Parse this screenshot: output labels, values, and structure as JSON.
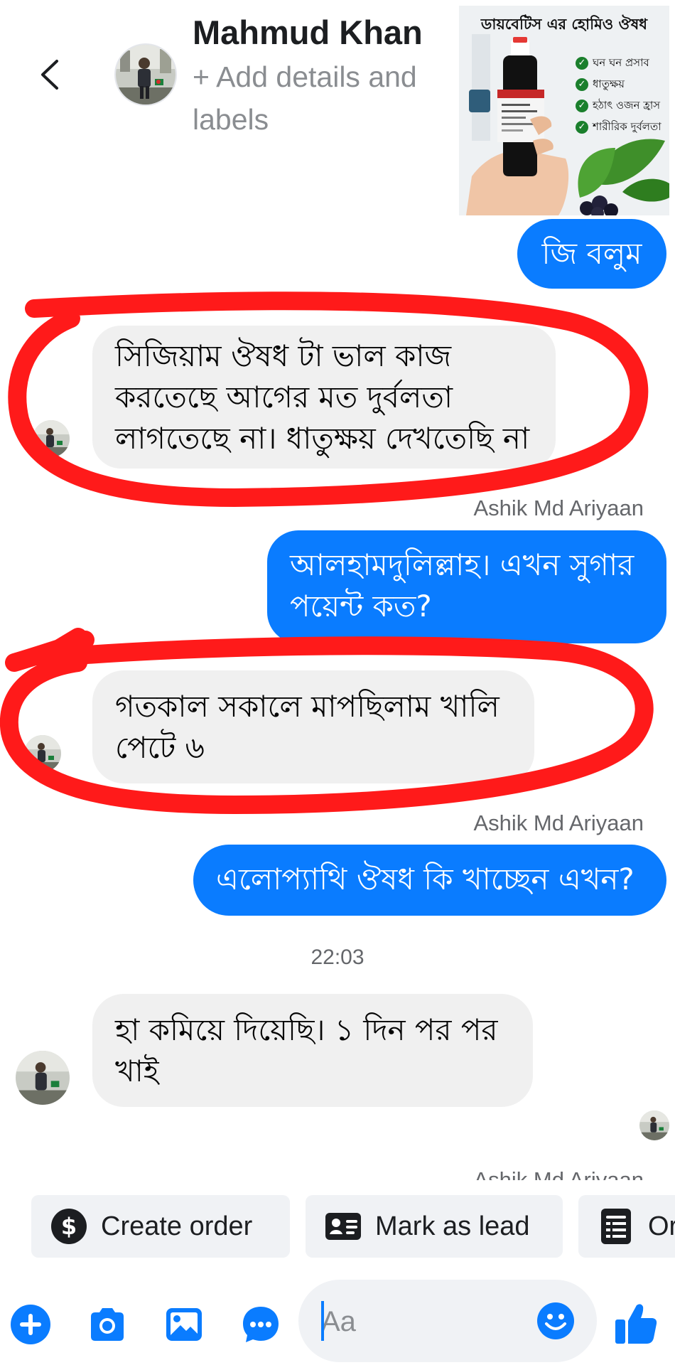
{
  "header": {
    "contact_name": "Mahmud Khan",
    "add_details_label": "+ Add details and labels"
  },
  "ad": {
    "title": "ডায়বেটিস এর হোমিও ঔষধ",
    "features": [
      "ঘন ঘন প্রসাব",
      "ধাতুক্ষয়",
      "হঠাৎ ওজন হ্রাস",
      "শারীরিক দুর্বলতা"
    ],
    "bottle_label": "Syzygium Jambolanum"
  },
  "messages": [
    {
      "dir": "out",
      "text": "জি বলুম"
    },
    {
      "dir": "in",
      "lines": [
        "সিজিয়াম ঔষধ টা ভাল কাজ",
        "করতেছে আগের মত দুর্বলতা",
        "লাগতেছে না। ধাতুক্ষয় দেখতেছি না"
      ]
    },
    {
      "sender": "Ashik Md Ariyaan"
    },
    {
      "dir": "out",
      "lines": [
        "আলহামদুলিল্লাহ। এখন সুগার",
        "পয়েন্ট কত?"
      ]
    },
    {
      "dir": "in",
      "lines": [
        "গতকাল সকালে মাপছিলাম খালি",
        "পেটে ৬"
      ]
    },
    {
      "sender": "Ashik Md Ariyaan"
    },
    {
      "dir": "out",
      "text": "এলোপ্যাথি ঔষধ কি খাচ্ছেন এখন?"
    },
    {
      "timestamp": "22:03"
    },
    {
      "dir": "in",
      "lines": [
        "হা কমিয়ে দিয়েছি। ১ দিন পর পর",
        "খাই"
      ]
    },
    {
      "sender": "Ashik Md Ariyaan"
    }
  ],
  "actions": {
    "create_order": "Create order",
    "mark_as_lead": "Mark as lead",
    "third_partial": "Or"
  },
  "composer": {
    "placeholder": "Aa"
  },
  "colors": {
    "accent": "#0a7cff",
    "incoming_bubble": "#f0f0f0",
    "annotation_red": "#ff1a1a"
  }
}
